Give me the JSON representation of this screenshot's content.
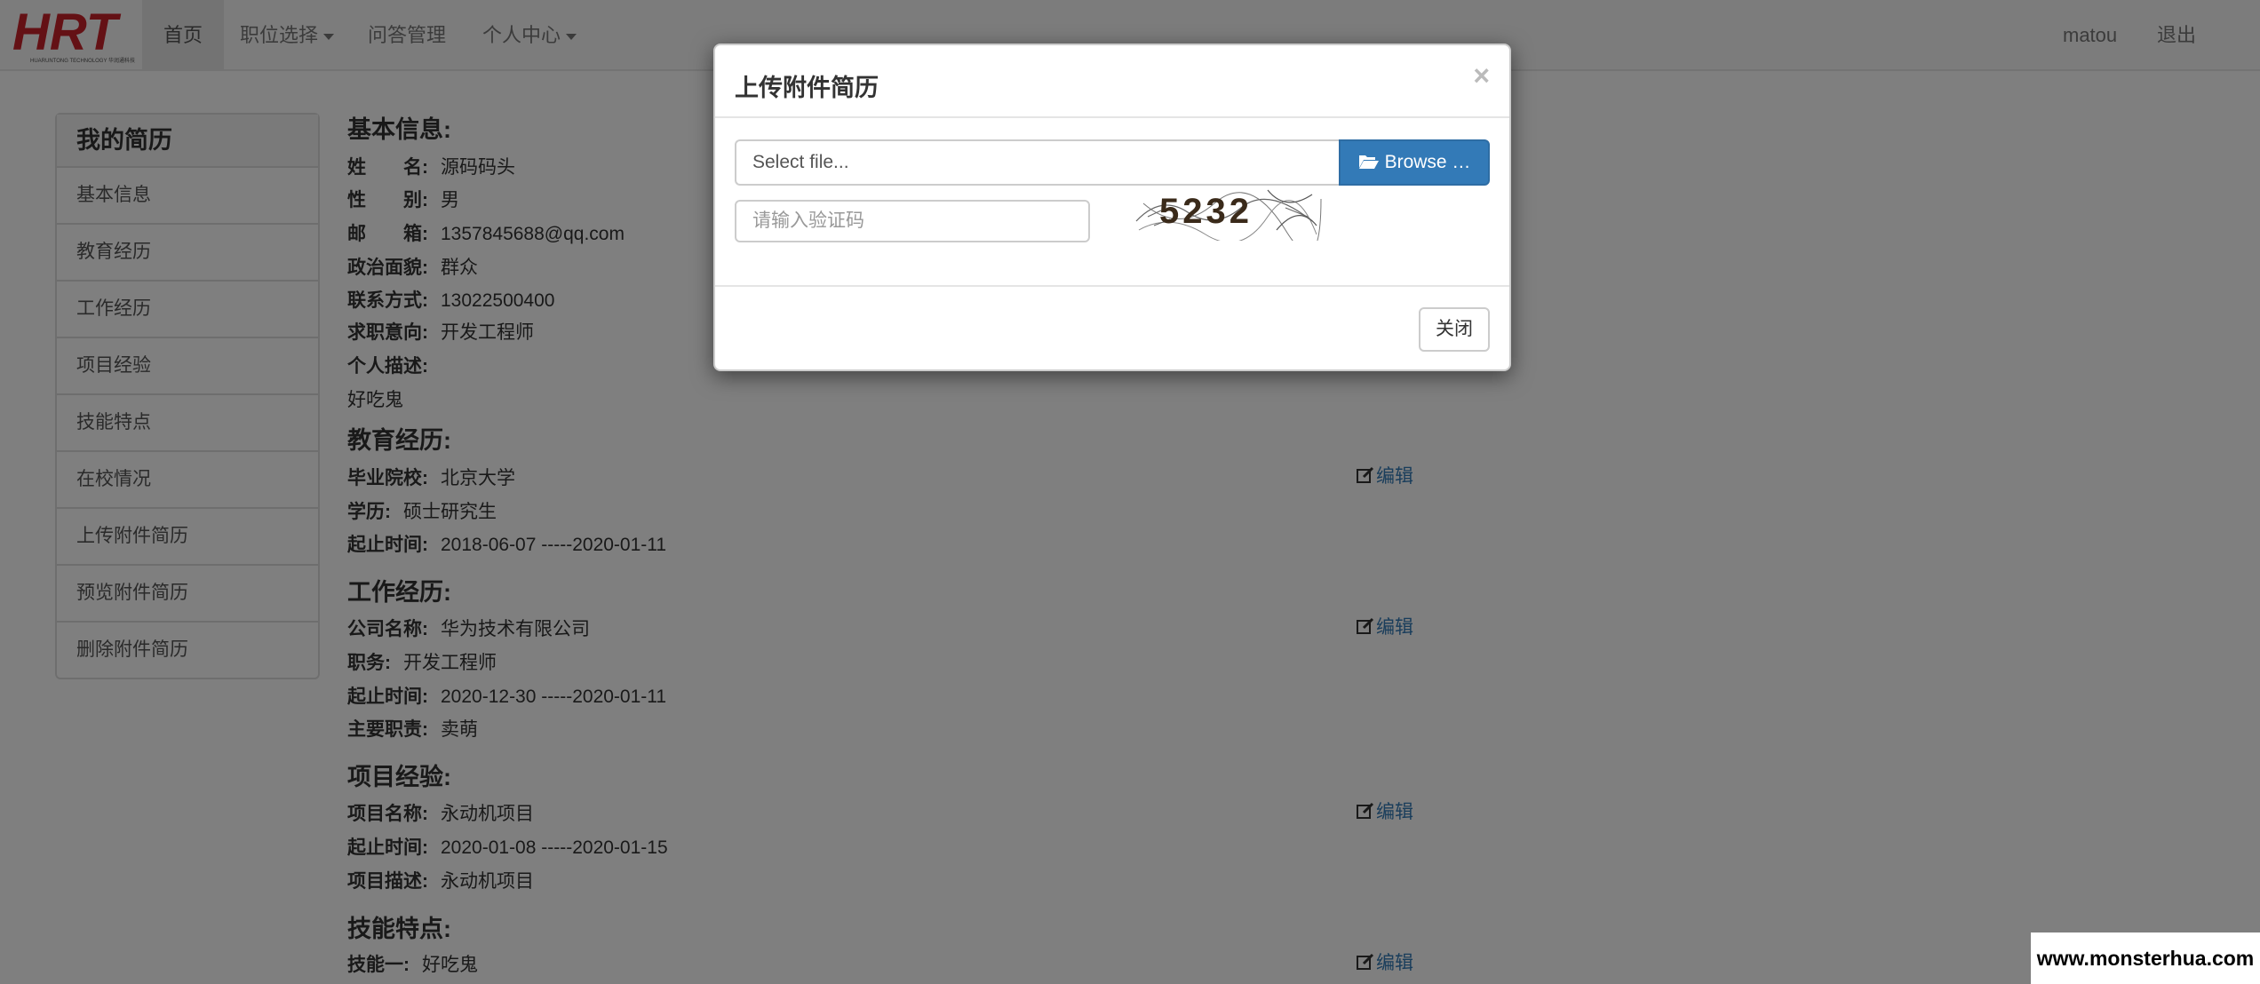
{
  "navbar": {
    "logo_text": "HRT",
    "logo_subtext": "HUARUNTONG TECHNOLOGY 华润通科技",
    "items": [
      {
        "label": "首页"
      },
      {
        "label": "职位选择"
      },
      {
        "label": "问答管理"
      },
      {
        "label": "个人中心"
      }
    ],
    "user": "matou",
    "logout": "退出"
  },
  "sidebar": {
    "title": "我的简历",
    "items": [
      {
        "label": "基本信息"
      },
      {
        "label": "教育经历"
      },
      {
        "label": "工作经历"
      },
      {
        "label": "项目经验"
      },
      {
        "label": "技能特点"
      },
      {
        "label": "在校情况"
      },
      {
        "label": "上传附件简历"
      },
      {
        "label": "预览附件简历"
      },
      {
        "label": "删除附件简历"
      }
    ]
  },
  "basic": {
    "title": "基本信息:",
    "name_label": "姓　　名:",
    "name": "源码码头",
    "gender_label": "性　　别:",
    "gender": "男",
    "email_label": "邮　　箱:",
    "email": "1357845688@qq.com",
    "political_label": "政治面貌:",
    "political": "群众",
    "phone_label": "联系方式:",
    "phone": "13022500400",
    "intent_label": "求职意向:",
    "intent": "开发工程师",
    "desc_label": "个人描述:",
    "desc": "好吃鬼"
  },
  "education": {
    "title": "教育经历:",
    "school_label": "毕业院校:",
    "school": "北京大学",
    "degree_label": "学历:",
    "degree": "硕士研究生",
    "period_label": "起止时间:",
    "period": "2018-06-07 -----2020-01-11",
    "edit": "编辑"
  },
  "work": {
    "title": "工作经历:",
    "company_label": "公司名称:",
    "company": "华为技术有限公司",
    "position_label": "职务:",
    "position": "开发工程师",
    "period_label": "起止时间:",
    "period": "2020-12-30 -----2020-01-11",
    "duty_label": "主要职责:",
    "duty": "卖萌",
    "edit": "编辑"
  },
  "project": {
    "title": "项目经验:",
    "name_label": "项目名称:",
    "name": "永动机项目",
    "period_label": "起止时间:",
    "period": "2020-01-08 -----2020-01-15",
    "desc_label": "项目描述:",
    "desc": "永动机项目",
    "edit": "编辑"
  },
  "skills": {
    "title": "技能特点:",
    "skill1_label": "技能一:",
    "skill1": "好吃鬼",
    "edit": "编辑"
  },
  "modal": {
    "title": "上传附件简历",
    "close_symbol": "×",
    "file_placeholder": "Select file...",
    "browse_label": "Browse …",
    "captcha_placeholder": "请输入验证码",
    "captcha_text": "5232",
    "close_button": "关闭"
  },
  "watermark": "www.monsterhua.com",
  "colors": {
    "primary": "#337ab7",
    "logo_red": "#c9232b",
    "navbar_bg": "#f8f8f8",
    "backdrop": "rgba(0,0,0,0.5)"
  }
}
